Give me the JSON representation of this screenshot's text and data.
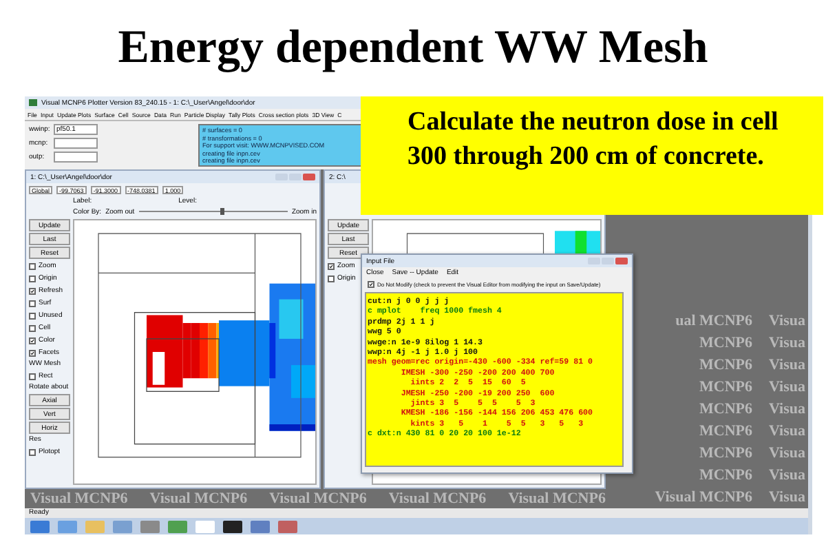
{
  "slide_title": "Energy dependent WW Mesh",
  "app": {
    "title": "Visual MCNP6 Plotter Version 83_240.15 - 1: C:\\_User\\Angel\\door\\dor",
    "menu": [
      "File",
      "Input",
      "Update Plots",
      "Surface",
      "Cell",
      "Source",
      "Data",
      "Run",
      "Particle Display",
      "Tally Plots",
      "Cross section plots",
      "3D View",
      "C"
    ],
    "files": [
      {
        "label": "wwinp:",
        "value": "pf50.1"
      },
      {
        "label": "mcnp:"
      },
      {
        "label": "outp:"
      }
    ],
    "console": [
      "# surfaces = 0",
      "# transformations = 0",
      "For support visit: WWW.MCNPVISED.COM",
      "creating file inpn.cev",
      "creating file inpn.cev"
    ],
    "plot_window_1": {
      "title": "1: C:\\_User\\Angel\\door\\dor",
      "fields": [
        "Global",
        "-99.7063",
        "-91.3000",
        "-748.0381",
        "1.000"
      ],
      "label_text": "Label:",
      "level_text": "Level:",
      "color_by": "Color By:",
      "zoom_out": "Zoom out",
      "zoom_in": "Zoom in",
      "zoom_slider": {
        "level": 0.55
      },
      "controls": [
        {
          "kind": "button",
          "label": "Update"
        },
        {
          "kind": "button",
          "label": "Last"
        },
        {
          "kind": "button",
          "label": "Reset"
        },
        {
          "kind": "check",
          "label": "Zoom",
          "checked": false
        },
        {
          "kind": "check",
          "label": "Origin",
          "checked": false
        },
        {
          "kind": "check",
          "label": "Refresh",
          "checked": true
        },
        {
          "kind": "check",
          "label": "Surf",
          "checked": false
        },
        {
          "kind": "check",
          "label": "Unused",
          "checked": false
        },
        {
          "kind": "check",
          "label": "Cell",
          "checked": false
        },
        {
          "kind": "check",
          "label": "Color",
          "checked": true
        },
        {
          "kind": "check",
          "label": "Facets",
          "checked": true
        },
        {
          "kind": "text",
          "label": "WW Mesh"
        },
        {
          "kind": "check",
          "label": "Rect",
          "checked": false
        },
        {
          "kind": "text",
          "label": "Rotate about"
        },
        {
          "kind": "button",
          "label": "Axial"
        },
        {
          "kind": "button",
          "label": "Vert"
        },
        {
          "kind": "button",
          "label": "Horiz"
        },
        {
          "kind": "text",
          "label": "Res"
        },
        {
          "kind": "check",
          "label": "Plotopt",
          "checked": false
        }
      ]
    },
    "plot_window_2": {
      "title": "2: C:\\",
      "controls": [
        {
          "kind": "button",
          "label": "Update"
        },
        {
          "kind": "button",
          "label": "Last"
        },
        {
          "kind": "button",
          "label": "Reset"
        },
        {
          "kind": "check",
          "label": "Zoom",
          "checked": true
        },
        {
          "kind": "check",
          "label": "Origin",
          "checked": false
        }
      ]
    },
    "input_file": {
      "title": "Input File",
      "menu": [
        "Close",
        "Save -- Update",
        "Edit"
      ],
      "do_not_modify": {
        "label": "Do Not Modify (check to prevent the Visual Editor from modifying the input on Save/Update)",
        "checked": true
      },
      "lines": [
        {
          "kind": "card",
          "text": "cut:n j 0 0 j j j"
        },
        {
          "kind": "comment",
          "text": "c mplot    freq 1000 fmesh 4"
        },
        {
          "kind": "card",
          "text": "prdmp 2j 1 1 j"
        },
        {
          "kind": "card",
          "text": "wwg 5 0"
        },
        {
          "kind": "card",
          "text": "wwge:n 1e-9 8ilog 1 14.3"
        },
        {
          "kind": "card",
          "text": "wwp:n 4j -1 j 1.0 j 100"
        },
        {
          "kind": "mesh",
          "text": "mesh geom=rec origin=-430 -600 -334 ref=59 81 0"
        },
        {
          "kind": "mesh",
          "text": "       IMESH -300 -250 -200 200 400 700"
        },
        {
          "kind": "mesh",
          "text": "         iints 2  2  5  15  60  5"
        },
        {
          "kind": "mesh",
          "text": "       JMESH -250 -200 -19 200 250  600"
        },
        {
          "kind": "mesh",
          "text": "         jints 3  5    5  5    5  3"
        },
        {
          "kind": "mesh",
          "text": "       KMESH -186 -156 -144 156 206 453 476 600"
        },
        {
          "kind": "mesh",
          "text": "         kints 3   5    1    5  5   3   5   3"
        },
        {
          "kind": "comment",
          "text": "c dxt:n 430 81 0 20 20 100 1e-12"
        }
      ]
    },
    "desktop_watermark": [
      {
        "left": "ual MCNP6",
        "right": "Visua"
      },
      {
        "left": "MCNP6",
        "right": "Visua"
      },
      {
        "left": "MCNP6",
        "right": "Visua"
      },
      {
        "left": "MCNP6",
        "right": "Visua"
      },
      {
        "left": "MCNP6",
        "right": "Visua"
      },
      {
        "left": "MCNP6",
        "right": "Visua"
      },
      {
        "left": "MCNP6",
        "right": "Visua"
      },
      {
        "left": "MCNP6",
        "right": "Visua"
      },
      {
        "left": "Visual MCNP6",
        "right": "Visua"
      }
    ],
    "bottom_watermark": [
      "Visual MCNP6",
      "Visual MCNP6",
      "Visual MCNP6",
      "Visual MCNP6",
      "Visual MCNP6"
    ],
    "status": "Ready"
  },
  "callout": "Calculate the neutron dose in cell 300 through 200 cm of concrete."
}
